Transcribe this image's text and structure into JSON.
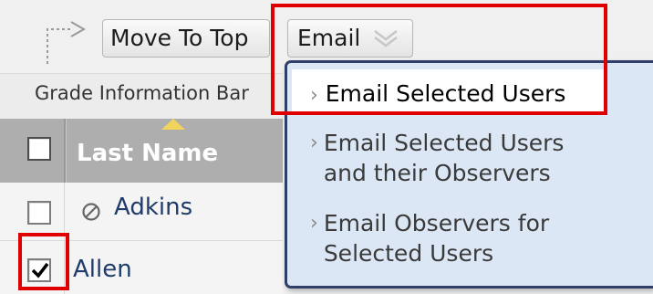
{
  "toolbar": {
    "move_to_top_label": "Move To Top",
    "email_label": "Email"
  },
  "subheader": {
    "grade_info_label": "Grade Information Bar"
  },
  "table": {
    "header": {
      "last_name": "Last Name"
    },
    "rows": [
      {
        "last_name": "Adkins",
        "checked": false,
        "status_icon": "unavailable-icon"
      },
      {
        "last_name": "Allen",
        "checked": true
      }
    ]
  },
  "email_menu": {
    "items": [
      {
        "label": "Email Selected Users"
      },
      {
        "label": "Email Selected Users\nand their Observers"
      },
      {
        "label": "Email Observers for\nSelected Users"
      }
    ]
  },
  "colors": {
    "callout": "#e00000",
    "menu_bg": "#dbe7f5",
    "menu_border": "#2f3f68",
    "header_bg": "#aeaeae",
    "link": "#1f3c6a"
  }
}
